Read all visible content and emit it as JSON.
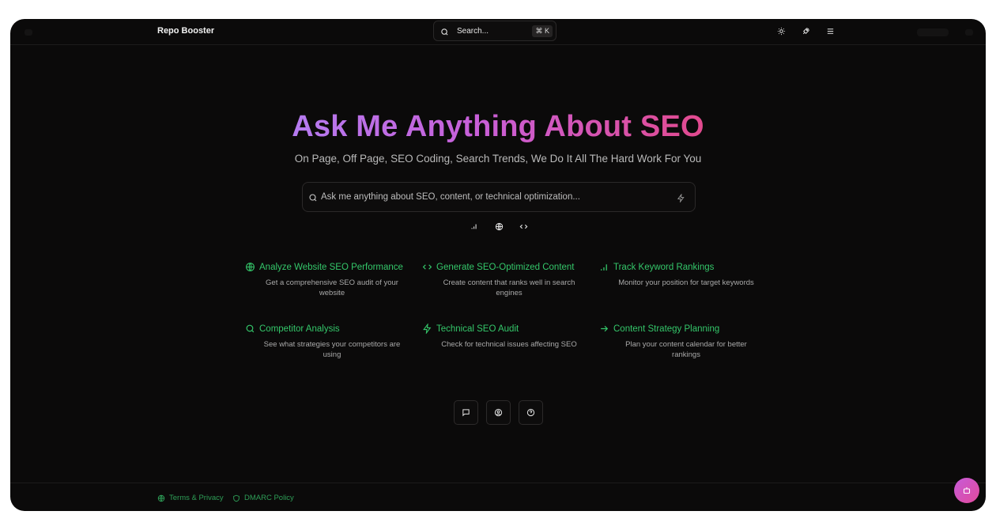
{
  "header": {
    "brand": "Repo Booster",
    "search_label": "Search...",
    "search_shortcut": "⌘ K",
    "icons": [
      "sun-icon",
      "rocket-icon",
      "menu-icon"
    ]
  },
  "hero": {
    "title": "Ask Me Anything About SEO",
    "subtitle": "On Page, Off Page, SEO Coding, Search Trends, We Do It All The Hard Work For You",
    "ask_placeholder": "Ask me anything about SEO, content, or technical optimization...",
    "modes": [
      "chart-icon",
      "globe-icon",
      "code-icon"
    ]
  },
  "features": [
    {
      "title": "Analyze Website SEO Performance",
      "desc": "Get a comprehensive SEO audit of your website",
      "icon": "globe-icon"
    },
    {
      "title": "Generate SEO-Optimized Content",
      "desc": "Create content that ranks well in search engines",
      "icon": "code-icon"
    },
    {
      "title": "Track Keyword Rankings",
      "desc": "Monitor your position for target keywords",
      "icon": "chart-icon"
    },
    {
      "title": "Competitor Analysis",
      "desc": "See what strategies your competitors are using",
      "icon": "search-icon"
    },
    {
      "title": "Technical SEO Audit",
      "desc": "Check for technical issues affecting SEO",
      "icon": "bolt-icon"
    },
    {
      "title": "Content Strategy Planning",
      "desc": "Plan your content calendar for better rankings",
      "icon": "arrow-right-icon"
    }
  ],
  "bottom_buttons": [
    "chat-icon",
    "user-circle-icon",
    "help-icon"
  ],
  "footer": {
    "terms": "Terms & Privacy",
    "dmarc": "DMARC Policy"
  },
  "colors": {
    "background": "#0b0a0a",
    "accent_green": "#34c76a",
    "gradient_start": "#b57bf0",
    "gradient_end": "#e24a8e"
  }
}
